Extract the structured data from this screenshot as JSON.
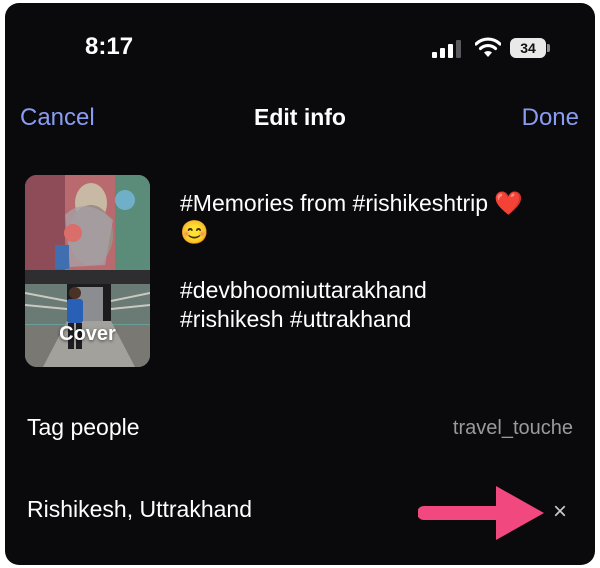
{
  "status_bar": {
    "time": "8:17",
    "battery": "34",
    "signal_bars": 3,
    "signal_bars_total": 4
  },
  "nav": {
    "cancel_label": "Cancel",
    "title": "Edit info",
    "done_label": "Done",
    "accent_color": "#8a9cf2"
  },
  "post": {
    "cover_label": "Cover",
    "caption_lines": [
      "#Memories from #rishikeshtrip",
      "#devbhoomiuttarakhand",
      "#rishikesh #uttrakhand"
    ],
    "caption_emoji_heart": "❤️",
    "caption_emoji_smile": "😊"
  },
  "tag_people": {
    "label": "Tag people",
    "value": "travel_touche"
  },
  "location": {
    "label": "Rishikesh, Uttrakhand",
    "clear_icon": "×"
  },
  "annotation": {
    "arrow_color": "#f0487f",
    "arrow_icon": "right-arrow-icon"
  }
}
